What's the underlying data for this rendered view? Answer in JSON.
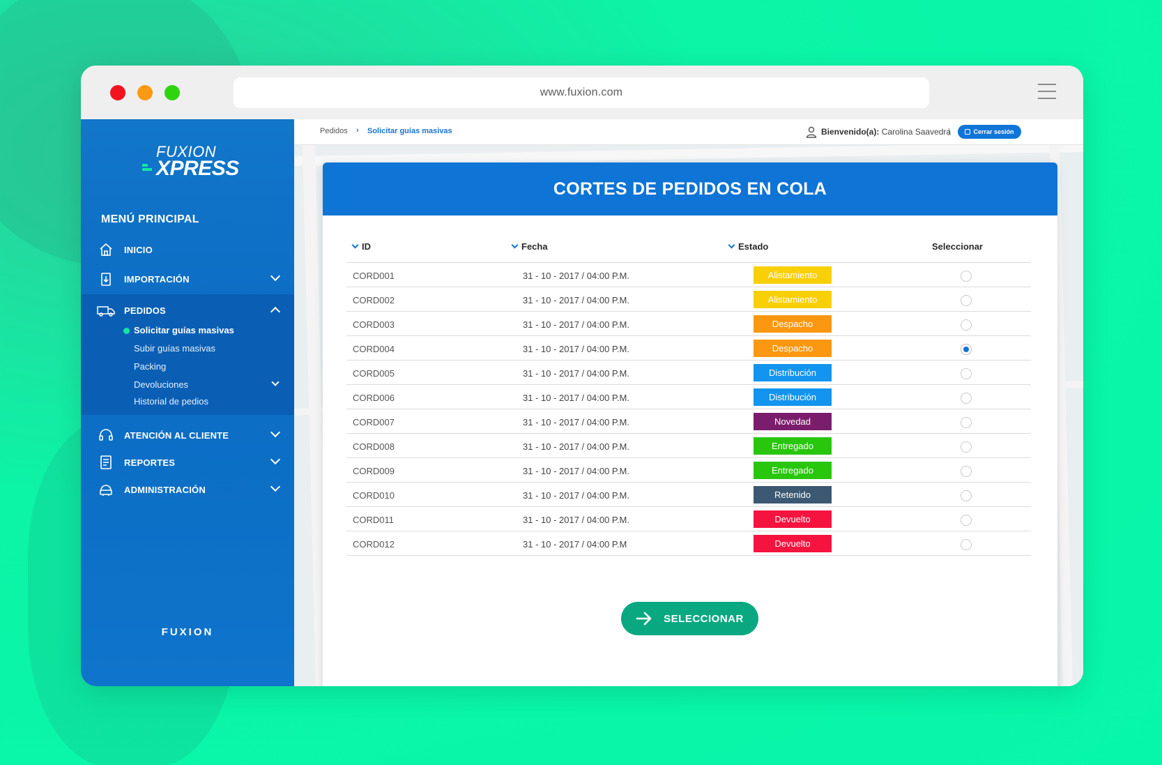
{
  "browser": {
    "url": "www.fuxion.com"
  },
  "colors": {
    "background": "#07f7aa",
    "sidebar": "#0b6cc3",
    "accent": "#0e74d6",
    "button": "#0aa881"
  },
  "sidebar": {
    "logo_top": "FUXION",
    "logo_bottom": "XPRESS",
    "menu_title": "MENÚ PRINCIPAL",
    "items": [
      {
        "label": "INICIO",
        "icon": "home-icon"
      },
      {
        "label": "IMPORTACIÓN",
        "icon": "import-icon"
      },
      {
        "label": "PEDIDOS",
        "icon": "truck-icon"
      },
      {
        "label": "ATENCIÓN AL CLIENTE",
        "icon": "headset-icon"
      },
      {
        "label": "REPORTES",
        "icon": "report-icon"
      },
      {
        "label": "ADMINISTRACIÓN",
        "icon": "admin-icon"
      }
    ],
    "pedidos_sub": [
      "Solicitar guías masivas",
      "Subir guías masivas",
      "Packing",
      "Devoluciones",
      "Historial de pedios"
    ],
    "footer_brand": "FUXION"
  },
  "topbar": {
    "breadcrumb_parent": "Pedidos",
    "breadcrumb_sep": "›",
    "breadcrumb_current": "Solicitar guías masivas",
    "welcome_label": "Bienvenido(a):",
    "user_name": "Carolina Saavedra",
    "separator": "|",
    "logout_label": "Cerrar sesión"
  },
  "card": {
    "title": "CORTES DE PEDIDOS EN COLA",
    "columns": {
      "id": "ID",
      "fecha": "Fecha",
      "estado": "Estado",
      "seleccionar": "Seleccionar"
    },
    "rows": [
      {
        "id": "CORD001",
        "fecha": "31 - 10 - 2017 / 04:00 P.M.",
        "estado": "Alistamiento",
        "color": "#f9cf07",
        "selected": false
      },
      {
        "id": "CORD002",
        "fecha": "31 - 10 - 2017 / 04:00 P.M.",
        "estado": "Alistamiento",
        "color": "#f9cf07",
        "selected": false
      },
      {
        "id": "CORD003",
        "fecha": "31 - 10 - 2017 / 04:00 P.M.",
        "estado": "Despacho",
        "color": "#fb9710",
        "selected": false
      },
      {
        "id": "CORD004",
        "fecha": "31 - 10 - 2017 / 04:00 P.M.",
        "estado": "Despacho",
        "color": "#fb9710",
        "selected": true
      },
      {
        "id": "CORD005",
        "fecha": "31 - 10 - 2017 / 04:00 P.M.",
        "estado": "Distribución",
        "color": "#1394ee",
        "selected": false
      },
      {
        "id": "CORD006",
        "fecha": "31 - 10 - 2017 / 04:00 P.M.",
        "estado": "Distribución",
        "color": "#1394ee",
        "selected": false
      },
      {
        "id": "CORD007",
        "fecha": "31 - 10 - 2017 / 04:00 P.M.",
        "estado": "Novedad",
        "color": "#7b1d6d",
        "selected": false
      },
      {
        "id": "CORD008",
        "fecha": "31 - 10 - 2017 / 04:00 P.M.",
        "estado": "Entregado",
        "color": "#29c60e",
        "selected": false
      },
      {
        "id": "CORD009",
        "fecha": "31 - 10 - 2017 / 04:00 P.M.",
        "estado": "Entregado",
        "color": "#29c60e",
        "selected": false
      },
      {
        "id": "CORD010",
        "fecha": "31 - 10 - 2017 / 04:00 P.M.",
        "estado": "Retenido",
        "color": "#3c5872",
        "selected": false
      },
      {
        "id": "CORD011",
        "fecha": "31 - 10 - 2017 / 04:00 P.M.",
        "estado": "Devuelto",
        "color": "#f5133f",
        "selected": false
      },
      {
        "id": "CORD012",
        "fecha": "31 - 10 - 2017 / 04:00 P.M",
        "estado": "Devuelto",
        "color": "#f5133f",
        "selected": false
      }
    ],
    "button_label": "SELECCIONAR"
  }
}
